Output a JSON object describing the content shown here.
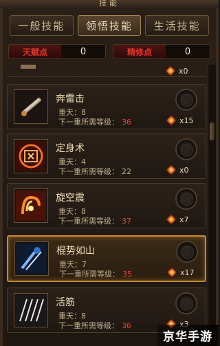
{
  "window": {
    "title": "技能"
  },
  "tabs": [
    {
      "label": "一般技能",
      "active": false
    },
    {
      "label": "领悟技能",
      "active": true
    },
    {
      "label": "生活技能",
      "active": false
    }
  ],
  "points": {
    "talent_label": "天赋点",
    "talent_value": "0",
    "refine_label": "精修点",
    "refine_value": "0"
  },
  "stub_cost": "x0",
  "skills": [
    {
      "name": "奔雷击",
      "level_text": "重天：8",
      "req_label": "下一重所需等级：",
      "req_value": "36",
      "req_red": true,
      "cost": "x15",
      "icon": "lightning-staff-icon",
      "selected": false
    },
    {
      "name": "定身术",
      "level_text": "重天：4",
      "req_label": "下一重所需等级：",
      "req_value": "22",
      "req_red": false,
      "cost": "x0",
      "icon": "freeze-rune-icon",
      "selected": false
    },
    {
      "name": "旋空震",
      "level_text": "重天：8",
      "req_label": "下一重所需等级：",
      "req_value": "37",
      "req_red": true,
      "cost": "x7",
      "icon": "whirlwind-icon",
      "selected": false
    },
    {
      "name": "棍势如山",
      "level_text": "重天：7",
      "req_label": "下一重所需等级：",
      "req_value": "35",
      "req_red": true,
      "cost": "x17",
      "icon": "staff-mountain-icon",
      "selected": true
    },
    {
      "name": "活筋",
      "level_text": "重天：8",
      "req_label": "下一重所需等级：",
      "req_value": "36",
      "req_red": true,
      "cost": "x3",
      "icon": "tendon-icon",
      "selected": false
    }
  ],
  "watermark": "京华手游",
  "colors": {
    "accent": "#c78a2e",
    "red": "#e0463a",
    "panel": "#1f1812"
  }
}
